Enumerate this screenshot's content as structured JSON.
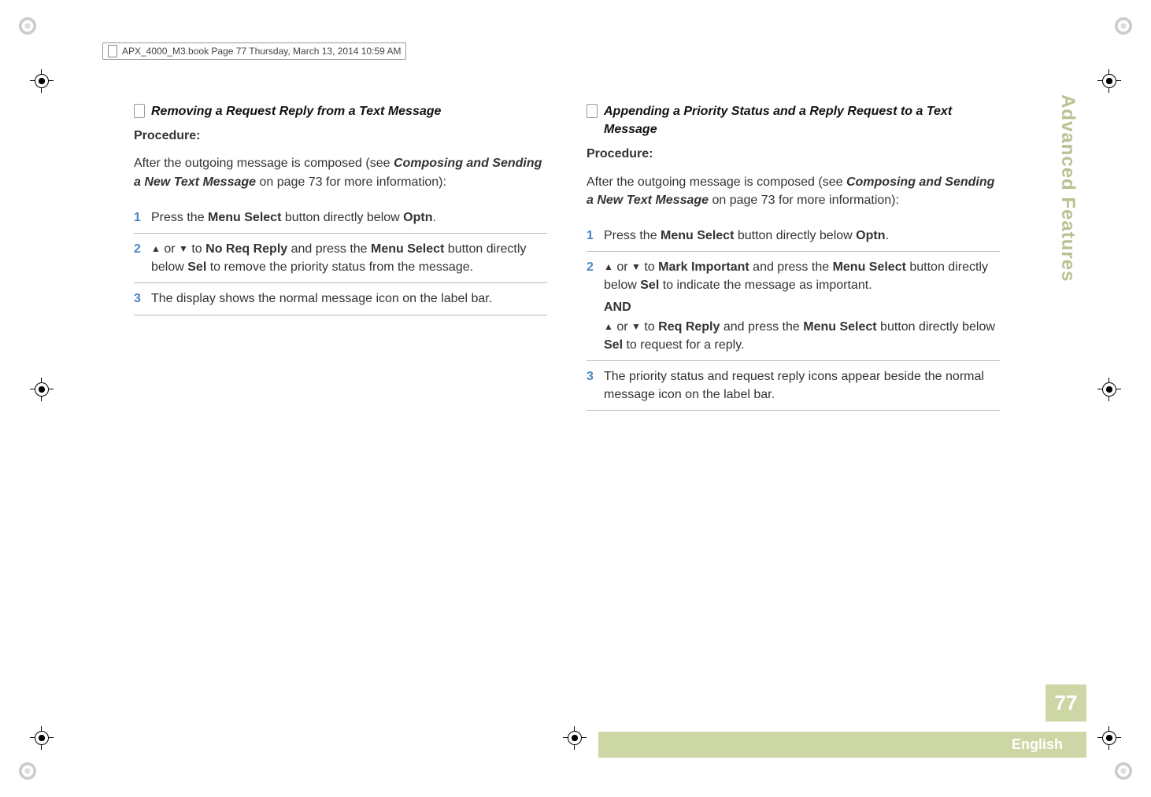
{
  "header": "APX_4000_M3.book  Page 77  Thursday, March 13, 2014  10:59 AM",
  "sidebar_title": "Advanced Features",
  "page_number": "77",
  "language": "English",
  "left": {
    "heading": "Removing a Request Reply from a Text Message",
    "procedure": "Procedure:",
    "intro_pre": "After the outgoing message is composed (see ",
    "intro_ref": "Composing and Sending a New Text Message",
    "intro_post": " on page 73 for more information):",
    "steps": [
      {
        "n": "1",
        "parts": [
          "Press the ",
          "Menu Select",
          " button directly below ",
          "Optn",
          "."
        ]
      },
      {
        "n": "2",
        "parts_a": [
          " or ",
          " to ",
          "No Req Reply",
          " and press the ",
          "Menu Select",
          " button directly below ",
          "Sel",
          " to remove the priority status from the message."
        ]
      },
      {
        "n": "3",
        "text": "The display shows the normal message icon on the label bar."
      }
    ]
  },
  "right": {
    "heading": "Appending a Priority Status and a Reply Request to a Text Message",
    "procedure": "Procedure:",
    "intro_pre": "After the outgoing message is composed (see ",
    "intro_ref": "Composing and Sending a New Text Message",
    "intro_post": " on page 73 for more information):",
    "steps": [
      {
        "n": "1",
        "parts": [
          "Press the ",
          "Menu Select",
          " button directly below ",
          "Optn",
          "."
        ]
      },
      {
        "n": "2",
        "parts_b": [
          " or ",
          " to ",
          "Mark Important",
          " and press the ",
          "Menu Select",
          " button directly below ",
          "Sel",
          " to indicate the message as important."
        ],
        "and": "AND",
        "parts_c": [
          " or ",
          " to ",
          "Req Reply",
          " and press the ",
          "Menu Select",
          " button directly below ",
          "Sel",
          " to request for a reply."
        ]
      },
      {
        "n": "3",
        "text": "The priority status and request reply icons appear beside the normal message icon on the label bar."
      }
    ]
  }
}
